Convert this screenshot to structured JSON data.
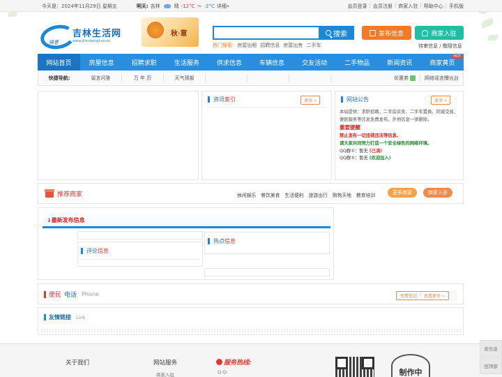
{
  "topbar": {
    "date_text": "今天是：2024年11月29日 星期五",
    "weather_label": "明天:",
    "city": "吉林",
    "condition": "晴",
    "temp_low": "-12°C",
    "temp_sep": "〜",
    "temp_high": "-2°C",
    "detail": "详细»",
    "links": [
      "会员登录",
      "会员注册",
      "商家入驻",
      "帮助中心",
      "手机版"
    ]
  },
  "header": {
    "logo_title": "吉林生活网",
    "logo_url": "www.jilinshenghuo.cn",
    "logo_mark": "得意",
    "banner_word": "秋·意",
    "search_placeholder": "",
    "search_button": "搜索",
    "hot_label": "热门搜索:",
    "hot_items": [
      "房屋出租",
      "招聘信息",
      "房屋出售",
      "二手车"
    ],
    "publish_button": "发布信息",
    "merchant_button": "商家入驻",
    "sub_links": "待审信息 / 敬阻信息"
  },
  "nav": {
    "items": [
      "网站首页",
      "房屋信息",
      "招聘求职",
      "生活服务",
      "供求信息",
      "车辆信息",
      "交友活动",
      "二手物品",
      "新闻资讯",
      "商家黄页"
    ],
    "hot_badge": "HOT"
  },
  "quick_nav": {
    "label": "快捷导航:",
    "items": [
      "留言问答",
      "万 年 历",
      "天气预报",
      "",
      "",
      "",
      ""
    ],
    "right": [
      "优惠券",
      "网络谣言曝光台"
    ]
  },
  "index_panel": {
    "title_a": "资讯",
    "title_b": "索引",
    "more": "更多 »"
  },
  "notice_panel": {
    "title": "网站公告",
    "more": "更多 »",
    "body": "本站提供：求职招聘、二手房买卖、二手车置换、同城交易、便民服务等信息免费发布，外地信息一律删除。",
    "reminder": "重要提醒",
    "warning": "禁止发布一切违规违法等信息,",
    "appeal": "请大家共同努力打造一个安全绿色的网络环境。",
    "qq1_label": "QQ群①：暂无",
    "qq1_status": "(已满)",
    "qq2_label": "QQ群②：暂无",
    "qq2_status": "(欢迎加入)"
  },
  "recommend": {
    "title": "推荐商家",
    "cats": [
      "休闲娱乐",
      "餐饮美食",
      "生活便利",
      "旅游出行",
      "购物天地",
      "教育培训"
    ],
    "more": "更多商家",
    "join": "商家入驻"
  },
  "latest": {
    "title": "↓最新发布信息",
    "comments_a": "评论",
    "comments_b": "信息",
    "hot_a": "热点",
    "hot_b": "信息"
  },
  "phone": {
    "title_a": "便民",
    "title_b": "电话",
    "en": "Phone",
    "register": "免费登记",
    "more": "查看更多 »"
  },
  "links": {
    "title": "友情链接",
    "en": "Link"
  },
  "footer": {
    "about": "关于我们",
    "service": "网站服务",
    "service_sub": "商家入驻",
    "hotline": "服务热线:",
    "qq": "Q Q:",
    "stamp": "制作中"
  },
  "side": {
    "publish": "发信息",
    "top": "回顶部"
  }
}
